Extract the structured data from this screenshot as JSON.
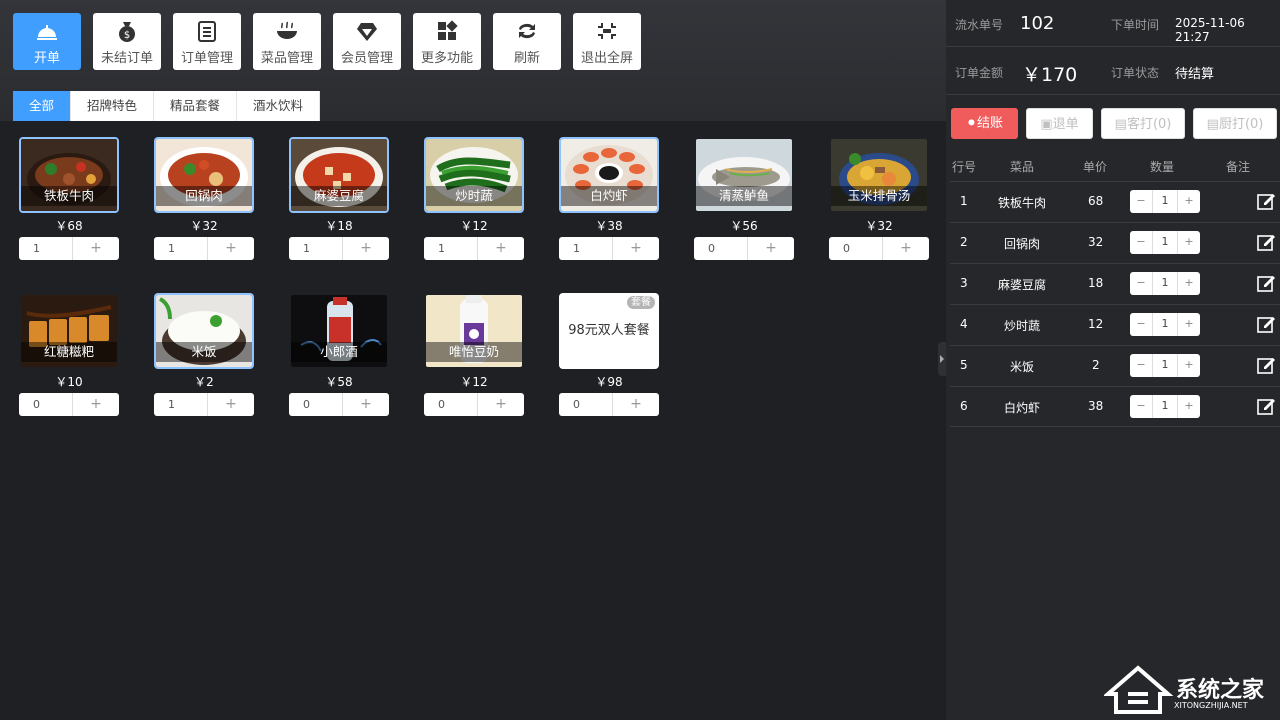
{
  "toolbar": [
    {
      "label": "开单",
      "icon": "service-bell-icon"
    },
    {
      "label": "未结订单",
      "icon": "money-bag-icon"
    },
    {
      "label": "订单管理",
      "icon": "clipboard-icon"
    },
    {
      "label": "菜品管理",
      "icon": "bowl-icon"
    },
    {
      "label": "会员管理",
      "icon": "diamond-icon"
    },
    {
      "label": "更多功能",
      "icon": "grid-icon"
    },
    {
      "label": "刷新",
      "icon": "refresh-icon"
    },
    {
      "label": "退出全屏",
      "icon": "exit-fullscreen-icon"
    }
  ],
  "tabs": [
    "全部",
    "招牌特色",
    "精品套餐",
    "酒水饮料"
  ],
  "dishes": [
    {
      "name": "铁板牛肉",
      "price": "￥68",
      "qty": "1"
    },
    {
      "name": "回锅肉",
      "price": "￥32",
      "qty": "1"
    },
    {
      "name": "麻婆豆腐",
      "price": "￥18",
      "qty": "1"
    },
    {
      "name": "炒时蔬",
      "price": "￥12",
      "qty": "1"
    },
    {
      "name": "白灼虾",
      "price": "￥38",
      "qty": "1"
    },
    {
      "name": "清蒸鲈鱼",
      "price": "￥56",
      "qty": "0"
    },
    {
      "name": "玉米排骨汤",
      "price": "￥32",
      "qty": "0"
    },
    {
      "name": "红糖糍粑",
      "price": "￥10",
      "qty": "0"
    },
    {
      "name": "米饭",
      "price": "￥2",
      "qty": "1"
    },
    {
      "name": "小郎酒",
      "price": "￥58",
      "qty": "0"
    },
    {
      "name": "唯怡豆奶",
      "price": "￥12",
      "qty": "0"
    },
    {
      "name": "98元双人套餐",
      "price": "￥98",
      "qty": "0",
      "badge": "套餐"
    }
  ],
  "order": {
    "serial_label": "流水单号",
    "serial": "102",
    "time_label": "下单时间",
    "time": "2025-11-06 21:27",
    "amount_label": "订单金额",
    "amount": "￥170",
    "status_label": "订单状态",
    "status": "待结算",
    "buttons": {
      "pay": "结账",
      "refund": "退单",
      "guest_print": "客打(0)",
      "kitchen_print": "厨打(0)"
    },
    "headers": {
      "no": "行号",
      "dish": "菜品",
      "price": "单价",
      "qty": "数量",
      "note": "备注"
    },
    "rows": [
      {
        "no": "1",
        "dish": "铁板牛肉",
        "price": "68",
        "qty": "1"
      },
      {
        "no": "2",
        "dish": "回锅肉",
        "price": "32",
        "qty": "1"
      },
      {
        "no": "3",
        "dish": "麻婆豆腐",
        "price": "18",
        "qty": "1"
      },
      {
        "no": "4",
        "dish": "炒时蔬",
        "price": "12",
        "qty": "1"
      },
      {
        "no": "5",
        "dish": "米饭",
        "price": "2",
        "qty": "1"
      },
      {
        "no": "6",
        "dish": "白灼虾",
        "price": "38",
        "qty": "1"
      }
    ]
  },
  "stepper": {
    "minus": "−",
    "plus": "+"
  },
  "watermark": {
    "title": "系统之家",
    "url": "XITONGZHIJIA.NET"
  },
  "colors": {
    "accent": "#409eff",
    "pay": "#f05b5b",
    "background": "#1f2023"
  }
}
